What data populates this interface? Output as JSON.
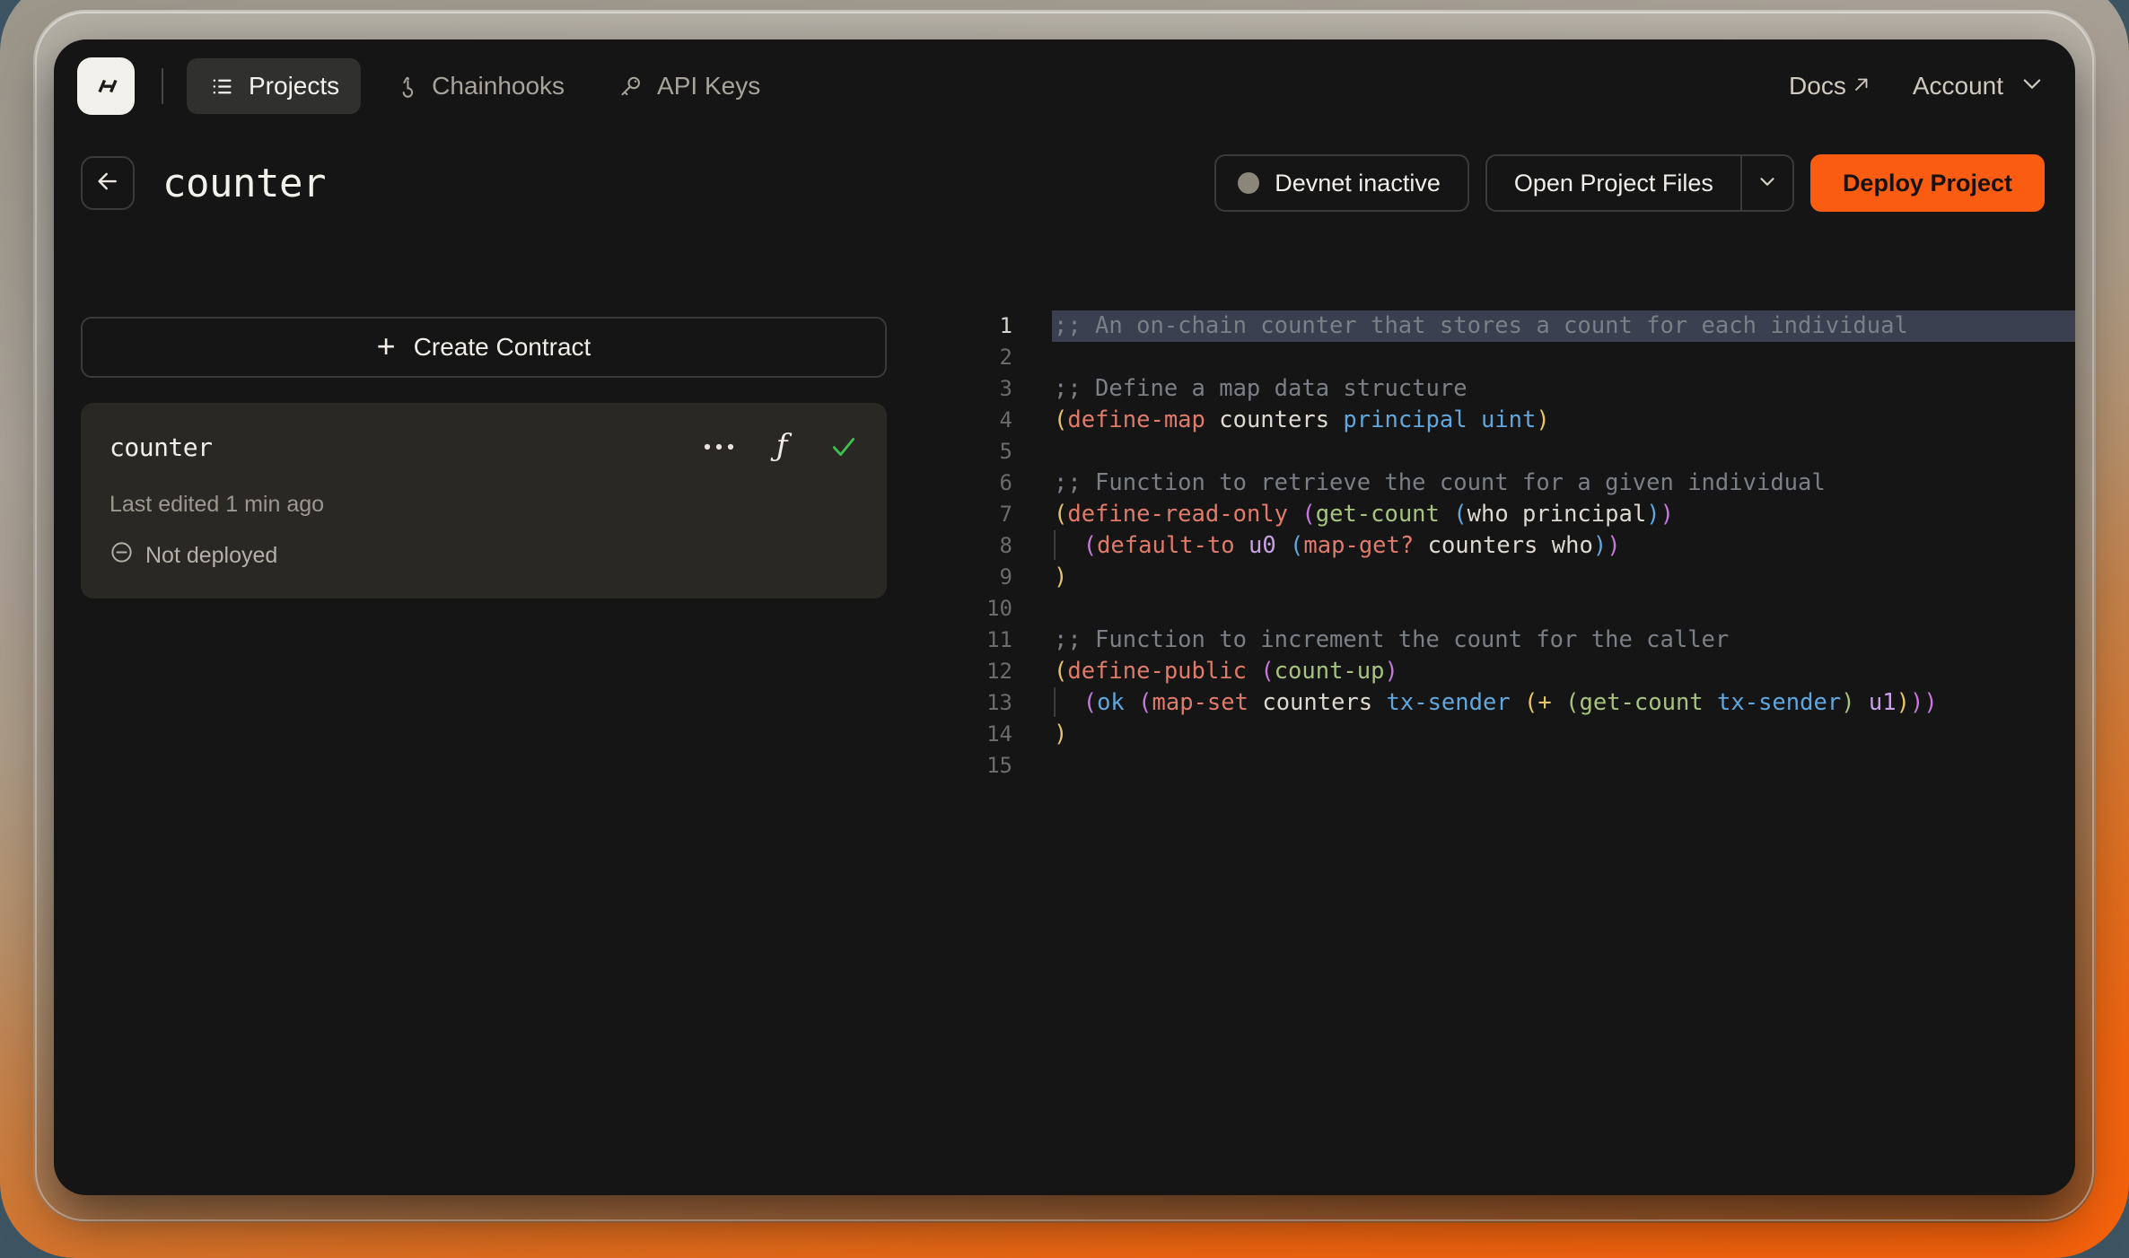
{
  "colors": {
    "accent_orange": "#fa5c12",
    "frame_gradient_top": "#9a9489",
    "frame_gradient_bottom": "#f5610b",
    "page_background": "#3d5562",
    "window_background": "#151515",
    "card_background": "#2a2825",
    "selection_highlight": "#3b4050",
    "status_dot": "#8b857a",
    "check_green": "#3ec04f"
  },
  "topnav": {
    "logo_alt": "hiro-logo",
    "items": [
      {
        "label": "Projects",
        "icon": "list-icon",
        "active": true
      },
      {
        "label": "Chainhooks",
        "icon": "hook-icon",
        "active": false
      },
      {
        "label": "API Keys",
        "icon": "key-icon",
        "active": false
      }
    ],
    "right": {
      "docs_label": "Docs",
      "docs_icon": "external-link-arrow-icon",
      "account_label": "Account",
      "account_icon": "chevron-down-icon"
    }
  },
  "subheader": {
    "back_icon": "arrow-left-icon",
    "title": "counter",
    "devnet_status_label": "Devnet inactive",
    "open_project_files_label": "Open Project Files",
    "open_project_files_caret_icon": "chevron-down-icon",
    "deploy_label": "Deploy Project"
  },
  "sidebar": {
    "create_contract_label": "Create Contract",
    "create_contract_icon": "plus-icon",
    "contract": {
      "name": "counter",
      "last_edited": "Last edited 1 min ago",
      "deploy_status": "Not deployed",
      "deploy_status_icon": "minus-circle-icon",
      "icons": [
        {
          "name": "more-options-icon",
          "glyph": "ellipsis"
        },
        {
          "name": "function-icon",
          "glyph": "f"
        },
        {
          "name": "check-icon",
          "glyph": "check"
        }
      ]
    }
  },
  "editor": {
    "language": "clarity",
    "selected_line": 1,
    "lines": [
      {
        "n": 1,
        "selected": true,
        "tokens": [
          {
            "t": ";; An on-chain counter that stores a count for each individual",
            "c": "t-comment"
          }
        ]
      },
      {
        "n": 2,
        "tokens": []
      },
      {
        "n": 3,
        "tokens": [
          {
            "t": ";; Define a map data structure",
            "c": "t-comment"
          }
        ]
      },
      {
        "n": 4,
        "tokens": [
          {
            "t": "(",
            "c": "t-paren-y"
          },
          {
            "t": "define-map",
            "c": "t-kw"
          },
          {
            "t": " counters ",
            "c": "t-var"
          },
          {
            "t": "principal",
            "c": "t-type"
          },
          {
            "t": " ",
            "c": "t-var"
          },
          {
            "t": "uint",
            "c": "t-type"
          },
          {
            "t": ")",
            "c": "t-paren-y"
          }
        ]
      },
      {
        "n": 5,
        "tokens": []
      },
      {
        "n": 6,
        "tokens": [
          {
            "t": ";; Function to retrieve the count for a given individual",
            "c": "t-comment"
          }
        ]
      },
      {
        "n": 7,
        "tokens": [
          {
            "t": "(",
            "c": "t-paren-y"
          },
          {
            "t": "define-read-only",
            "c": "t-kw"
          },
          {
            "t": " ",
            "c": "t-var"
          },
          {
            "t": "(",
            "c": "t-paren-m"
          },
          {
            "t": "get-count",
            "c": "t-fn"
          },
          {
            "t": " ",
            "c": "t-var"
          },
          {
            "t": "(",
            "c": "t-paren-b"
          },
          {
            "t": "who principal",
            "c": "t-var"
          },
          {
            "t": ")",
            "c": "t-paren-b"
          },
          {
            "t": ")",
            "c": "t-paren-m"
          }
        ]
      },
      {
        "n": 8,
        "guide": true,
        "tokens": [
          {
            "t": "  ",
            "c": "t-var"
          },
          {
            "t": "(",
            "c": "t-paren-m"
          },
          {
            "t": "default-to",
            "c": "t-kw"
          },
          {
            "t": " ",
            "c": "t-var"
          },
          {
            "t": "u0",
            "c": "t-num"
          },
          {
            "t": " ",
            "c": "t-var"
          },
          {
            "t": "(",
            "c": "t-paren-b"
          },
          {
            "t": "map-get?",
            "c": "t-kw"
          },
          {
            "t": " counters who",
            "c": "t-var"
          },
          {
            "t": ")",
            "c": "t-paren-b"
          },
          {
            "t": ")",
            "c": "t-paren-m"
          }
        ]
      },
      {
        "n": 9,
        "tokens": [
          {
            "t": ")",
            "c": "t-paren-y"
          }
        ]
      },
      {
        "n": 10,
        "tokens": []
      },
      {
        "n": 11,
        "tokens": [
          {
            "t": ";; Function to increment the count for the caller",
            "c": "t-comment"
          }
        ]
      },
      {
        "n": 12,
        "tokens": [
          {
            "t": "(",
            "c": "t-paren-y"
          },
          {
            "t": "define-public",
            "c": "t-kw"
          },
          {
            "t": " ",
            "c": "t-var"
          },
          {
            "t": "(",
            "c": "t-paren-m"
          },
          {
            "t": "count-up",
            "c": "t-fn"
          },
          {
            "t": ")",
            "c": "t-paren-m"
          }
        ]
      },
      {
        "n": 13,
        "guide": true,
        "tokens": [
          {
            "t": "  ",
            "c": "t-var"
          },
          {
            "t": "(",
            "c": "t-paren-m"
          },
          {
            "t": "ok",
            "c": "t-blue"
          },
          {
            "t": " ",
            "c": "t-var"
          },
          {
            "t": "(",
            "c": "t-paren-m"
          },
          {
            "t": "map-set",
            "c": "t-kw"
          },
          {
            "t": " counters ",
            "c": "t-var"
          },
          {
            "t": "tx-sender",
            "c": "t-blue"
          },
          {
            "t": " ",
            "c": "t-var"
          },
          {
            "t": "(",
            "c": "t-paren-y"
          },
          {
            "t": "+",
            "c": "t-paren-y"
          },
          {
            "t": " ",
            "c": "t-var"
          },
          {
            "t": "(",
            "c": "t-paren-g"
          },
          {
            "t": "get-count",
            "c": "t-fn"
          },
          {
            "t": " ",
            "c": "t-var"
          },
          {
            "t": "tx-sender",
            "c": "t-blue"
          },
          {
            "t": ")",
            "c": "t-paren-g"
          },
          {
            "t": " ",
            "c": "t-var"
          },
          {
            "t": "u1",
            "c": "t-num"
          },
          {
            "t": ")",
            "c": "t-paren-y"
          },
          {
            "t": ")",
            "c": "t-paren-m"
          },
          {
            "t": ")",
            "c": "t-paren-m"
          }
        ]
      },
      {
        "n": 14,
        "tokens": [
          {
            "t": ")",
            "c": "t-paren-y"
          }
        ]
      },
      {
        "n": 15,
        "tokens": []
      }
    ]
  }
}
